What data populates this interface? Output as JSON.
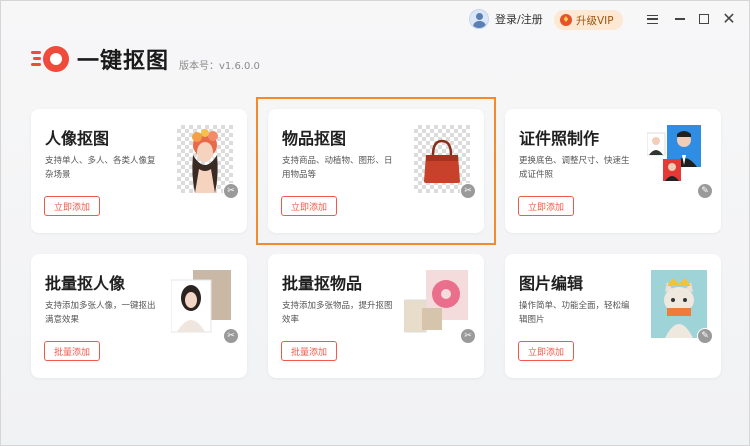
{
  "header": {
    "user_label": "登录/注册",
    "vip_label": "升级VIP"
  },
  "logo": {
    "title": "一键抠图",
    "version": "版本号：v1.6.0.0"
  },
  "colors": {
    "accent": "#ef4b3a",
    "highlight": "#f28a2e",
    "vip_bg": "#fde9d3"
  },
  "cards": [
    {
      "title": "人像抠图",
      "desc": "支持单人、多人、各类人像复杂场景",
      "button": "立即添加",
      "icon": "portrait-icon"
    },
    {
      "title": "物品抠图",
      "desc": "支持商品、动植物、图形、日用物品等",
      "button": "立即添加",
      "icon": "handbag-icon"
    },
    {
      "title": "证件照制作",
      "desc": "更换底色、调整尺寸、快速生成证件照",
      "button": "立即添加",
      "icon": "id-photo-icon"
    },
    {
      "title": "批量抠人像",
      "desc": "支持添加多张人像，一键抠出满意效果",
      "button": "批量添加",
      "icon": "batch-portrait-icon"
    },
    {
      "title": "批量抠物品",
      "desc": "支持添加多张物品，提升抠图效率",
      "button": "批量添加",
      "icon": "batch-object-icon"
    },
    {
      "title": "图片编辑",
      "desc": "操作简单、功能全面，轻松编辑图片",
      "button": "立即添加",
      "icon": "image-edit-icon"
    }
  ]
}
